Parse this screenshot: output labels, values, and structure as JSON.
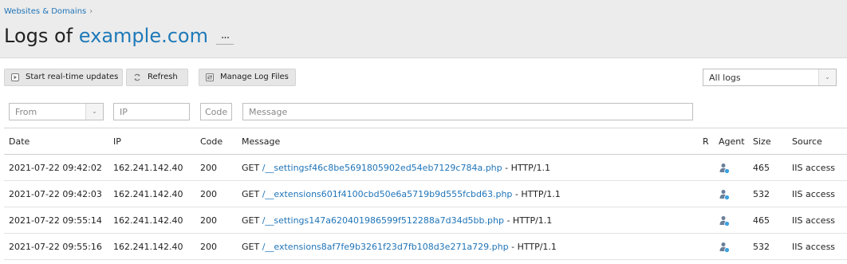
{
  "breadcrumb": {
    "label": "Websites & Domains"
  },
  "page": {
    "title_prefix": "Logs of",
    "domain": "example.com",
    "more_label": "..."
  },
  "toolbar": {
    "realtime_label": "Start real-time updates",
    "refresh_label": "Refresh",
    "manage_label": "Manage Log Files"
  },
  "log_filter": {
    "selected": "All logs"
  },
  "filters": {
    "from_placeholder": "From",
    "ip_placeholder": "IP",
    "code_placeholder": "Code",
    "message_placeholder": "Message"
  },
  "table": {
    "columns": {
      "date": "Date",
      "ip": "IP",
      "code": "Code",
      "message": "Message",
      "r": "R",
      "agent": "Agent",
      "size": "Size",
      "source": "Source"
    },
    "rows": [
      {
        "date": "2021-07-22 09:42:02",
        "ip": "162.241.142.40",
        "code": "200",
        "method": "GET",
        "path": "/__settingsf46c8be5691805902ed54eb7129c784a.php",
        "protocol": "- HTTP/1.1",
        "r": "",
        "size": "465",
        "source": "IIS access"
      },
      {
        "date": "2021-07-22 09:42:03",
        "ip": "162.241.142.40",
        "code": "200",
        "method": "GET",
        "path": "/__extensions601f4100cbd50e6a5719b9d555fcbd63.php",
        "protocol": "- HTTP/1.1",
        "r": "",
        "size": "532",
        "source": "IIS access"
      },
      {
        "date": "2021-07-22 09:55:14",
        "ip": "162.241.142.40",
        "code": "200",
        "method": "GET",
        "path": "/__settings147a620401986599f512288a7d34d5bb.php",
        "protocol": "- HTTP/1.1",
        "r": "",
        "size": "465",
        "source": "IIS access"
      },
      {
        "date": "2021-07-22 09:55:16",
        "ip": "162.241.142.40",
        "code": "200",
        "method": "GET",
        "path": "/__extensions8af7fe9b3261f23d7fb108d3e271a729.php",
        "protocol": "- HTTP/1.1",
        "r": "",
        "size": "532",
        "source": "IIS access"
      }
    ]
  },
  "icons": {
    "realtime": "play-icon",
    "refresh": "refresh-icon",
    "manage": "settings-icon",
    "agent": "user-agent-icon"
  },
  "colors": {
    "link": "#1f74b8",
    "header_bg": "#ececec"
  }
}
